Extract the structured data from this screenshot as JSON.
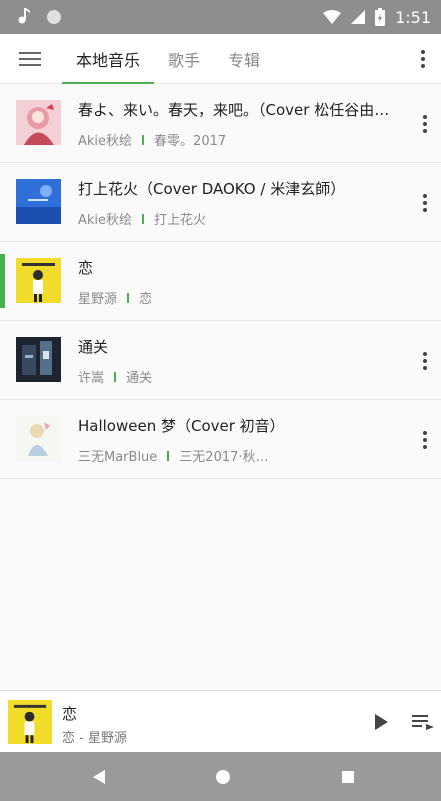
{
  "status_bar": {
    "time": "1:51"
  },
  "app_bar": {
    "tabs": [
      {
        "label": "本地音乐"
      },
      {
        "label": "歌手"
      },
      {
        "label": "专辑"
      }
    ]
  },
  "songs": [
    {
      "title": "春よ、来い。春天，来吧。（Cover 松任谷由实）",
      "artist": "Akie秋绘",
      "album": "春零。2017"
    },
    {
      "title": "打上花火（Cover DAOKO / 米津玄師）",
      "artist": "Akie秋绘",
      "album": "打上花火"
    },
    {
      "title": "恋",
      "artist": "星野源",
      "album": "恋"
    },
    {
      "title": "通关",
      "artist": "许嵩",
      "album": "通关"
    },
    {
      "title": "Halloween 梦（Cover 初音）",
      "artist": "三无MarBlue",
      "album": "三无2017·秋…"
    }
  ],
  "now_playing": {
    "title": "恋",
    "subtitle": "恋 - 星野源"
  },
  "colors": {
    "accent": "#4caf50",
    "status_bar": "#8e8e8e",
    "nav_bar": "#9a9a9a"
  }
}
